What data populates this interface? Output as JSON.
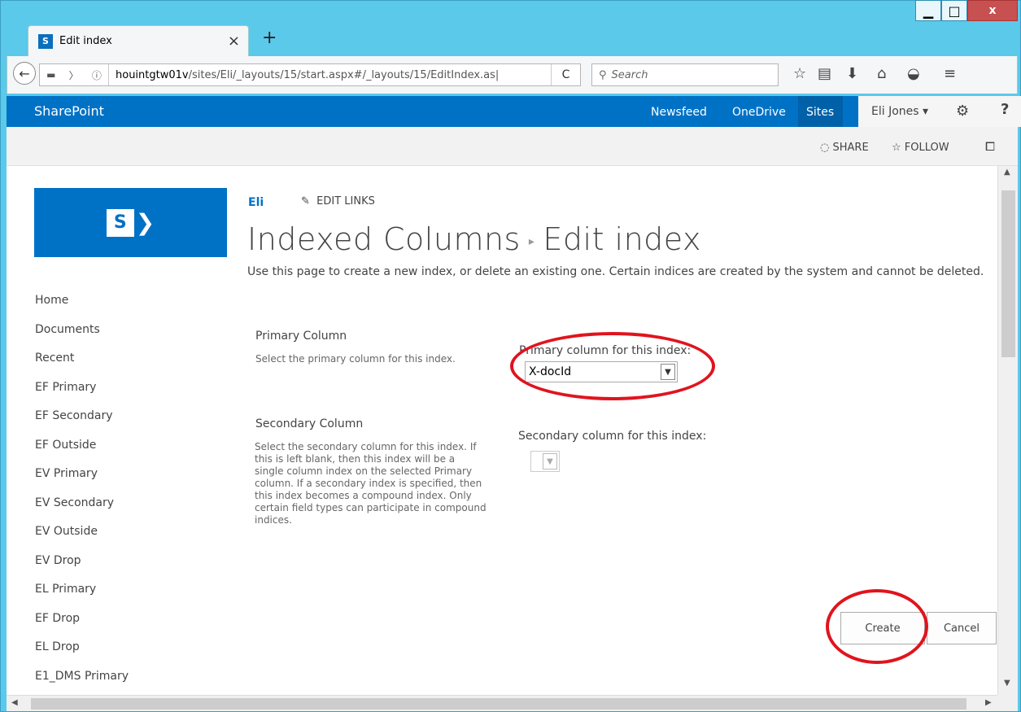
{
  "window": {
    "minimize": "▁",
    "maximize": "□",
    "close": "x"
  },
  "tab": {
    "favicon": "S",
    "title": "Edit index",
    "close": "×",
    "new_tab": "+"
  },
  "navbar": {
    "back": "←",
    "url_host": "houintgtw01v",
    "url_path": "/sites/Eli/_layouts/15/start.aspx#/_layouts/15/EditIndex.as|",
    "reload": "C",
    "search_placeholder": "Search",
    "icons": [
      "star-icon",
      "reading-list-icon",
      "download-icon",
      "home-icon",
      "pocket-icon",
      "menu-icon"
    ]
  },
  "suitebar": {
    "brand": "SharePoint",
    "links": [
      "Newsfeed",
      "OneDrive",
      "Sites"
    ],
    "user": "Eli Jones ▾",
    "help": "?"
  },
  "ribbon": {
    "share": "SHARE",
    "follow": "FOLLOW"
  },
  "site": {
    "link": "Eli",
    "edit_links": "EDIT LINKS",
    "breadcrumb_parent": "Indexed Columns",
    "breadcrumb_current": "Edit index"
  },
  "quicklaunch": {
    "items": [
      "Home",
      "Documents",
      "Recent",
      "EF Primary",
      "EF Secondary",
      "EF Outside",
      "EV Primary",
      "EV Secondary",
      "EV Outside",
      "EV Drop",
      "EL Primary",
      "EF Drop",
      "EL Drop",
      "E1_DMS Primary"
    ]
  },
  "form": {
    "intro": "Use this page to create a new index, or delete an existing one. Certain indices are created by the system and cannot be deleted.",
    "primary": {
      "title": "Primary Column",
      "desc": "Select the primary column for this index.",
      "label": "Primary column for this index:",
      "value": "X-docId"
    },
    "secondary": {
      "title": "Secondary Column",
      "desc": "Select the secondary column for this index. If this is left blank, then this index will be a single column index on the selected Primary column. If a secondary index is specified, then this index becomes a compound index. Only certain field types can participate in compound indices.",
      "label": "Secondary column for this index:",
      "value": ""
    },
    "create": "Create",
    "cancel": "Cancel"
  },
  "colors": {
    "suite_blue": "#0072c6",
    "annotation_red": "#e0141e"
  }
}
